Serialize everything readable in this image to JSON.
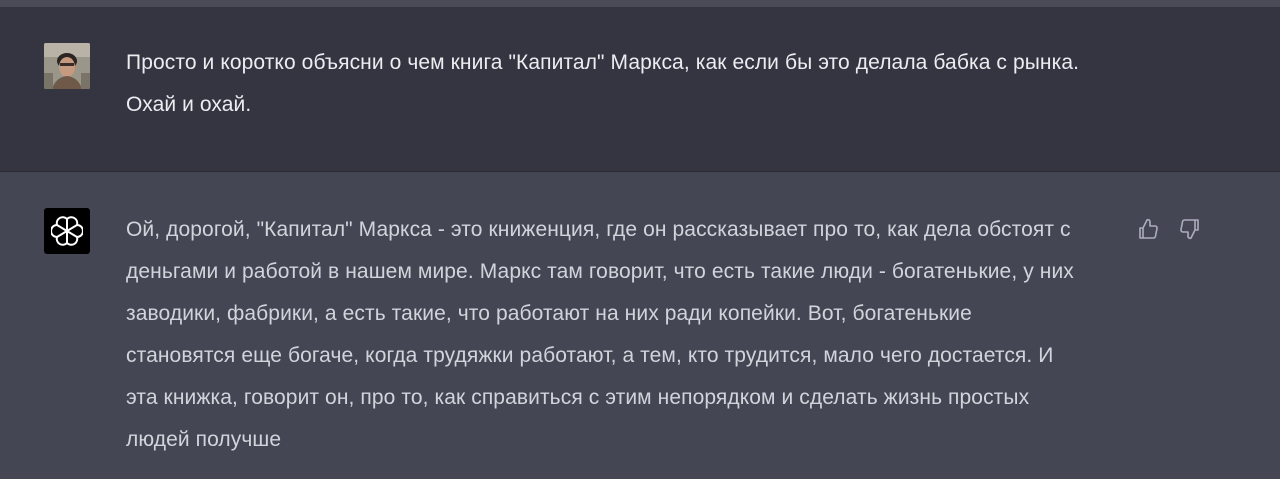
{
  "conversation": {
    "user_message": {
      "text": "Просто и коротко объясни о чем книга \"Капитал\" Маркса, как если бы это делала бабка с рынка. Охай и охай.",
      "avatar_icon": "user-photo-avatar"
    },
    "assistant_message": {
      "text": "Ой, дорогой, \"Капитал\" Маркса - это книженция, где он рассказывает про то, как дела обстоят с деньгами и работой в нашем мире. Маркс там говорит, что есть такие люди - богатенькие, у них заводики, фабрики, а есть такие, что работают на них ради копейки. Вот, богатенькие становятся еще богаче, когда трудяжки работают, а тем, кто трудится, мало чего достается. И эта книжка, говорит он, про то, как справиться с этим непорядком и сделать жизнь простых людей получше",
      "avatar_icon": "openai-logo-icon",
      "feedback": {
        "thumbs_up_icon": "thumbs-up-icon",
        "thumbs_down_icon": "thumbs-down-icon"
      }
    }
  },
  "colors": {
    "user_bg": "#343541",
    "assistant_bg": "#444654",
    "text": "#ececf1"
  }
}
